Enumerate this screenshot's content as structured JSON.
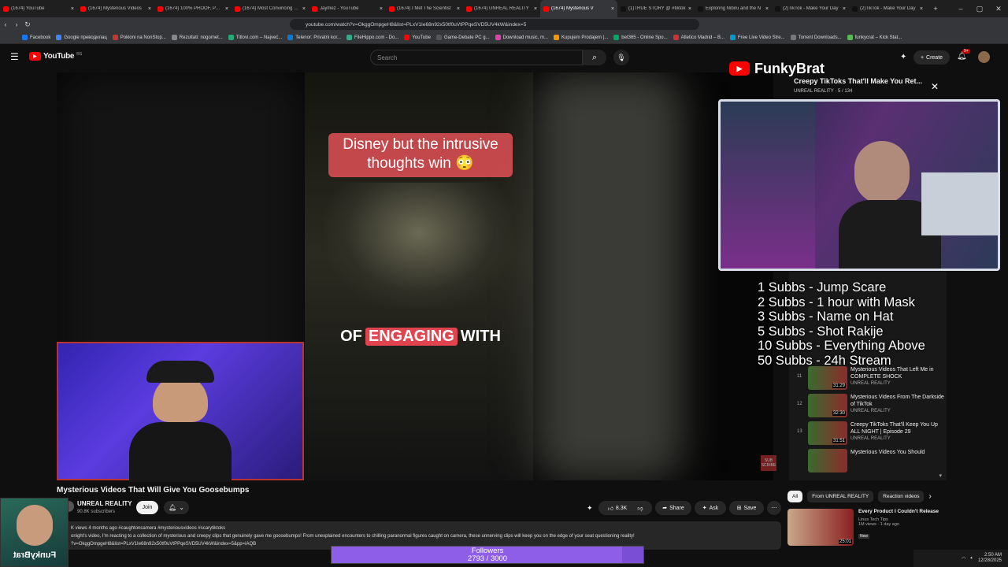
{
  "browser": {
    "tabs": [
      {
        "label": "(1674) YouTube",
        "active": false,
        "color": "#ff0000"
      },
      {
        "label": "(1674) Mysterious Videos",
        "active": false,
        "color": "#ff0000"
      },
      {
        "label": "(1674) 100% PROOF, PARA",
        "active": false,
        "color": "#ff0000"
      },
      {
        "label": "(1674) Most Convincing Evi",
        "active": false,
        "color": "#ff0000"
      },
      {
        "label": "Jaymez - YouTube",
        "active": false,
        "color": "#ff0000"
      },
      {
        "label": "(1674) I Met The Scientist",
        "active": false,
        "color": "#ff0000"
      },
      {
        "label": "(1674) UNREAL REALITY",
        "active": false,
        "color": "#ff0000"
      },
      {
        "label": "(1674) Mysterious V",
        "active": true,
        "color": "#ff0000"
      },
      {
        "label": "(1)TRUE STORY @ #tiktok",
        "active": false,
        "color": "#111111"
      },
      {
        "label": "Exploring Nibiru and the N",
        "active": false,
        "color": "#111111"
      },
      {
        "label": "(2)TikTok - Make Your Day",
        "active": false,
        "color": "#111111"
      },
      {
        "label": "(2)TikTok - Make Your Day",
        "active": false,
        "color": "#111111"
      }
    ],
    "url": "youtube.com/watch?v=OkggOmpgeH8&list=PLxV1Ie68n92x50tf0uVtPPqeSVD5UV4kW&index=5",
    "bookmarks": [
      "Facebook",
      "Google преводилац",
      "Pokloni na NonStop...",
      "Rezultati: nogomet...",
      "Titlovi.com – Najveć...",
      "Telenor: Privatni kor...",
      "FileHippo.com - Do...",
      "YouTube",
      "Game-Debate PC g...",
      "Download music, m...",
      "Kupujem Prodajem |...",
      "bet365 - Online Spo...",
      "Atletico Madrid – B...",
      "Free Live Video Stre...",
      "Torrent Downloads...",
      "funkycrat – Kick Stat..."
    ]
  },
  "youtube": {
    "logo": "YouTube",
    "region": "RS",
    "search_placeholder": "Search",
    "create_label": "Create",
    "notif_count": "9+"
  },
  "video": {
    "caption_top": "Disney but the intrusive thoughts win 😳",
    "caption_pre": "OF",
    "caption_hl": "ENGAGING",
    "caption_post": "WITH",
    "title": "Mysterious Videos That Will Give You Goosebumps",
    "channel": "UNREAL REALITY",
    "subscribers": "90.8K subscribers",
    "join": "Join",
    "likes": "8.3K",
    "share": "Share",
    "ask": "Ask",
    "save": "Save",
    "desc_line1": "K views  4 months ago  #caughtoncamera #mysteriousvideos #scarytiktoks",
    "desc_line2": "onight's video, I'm reacting to a collection of mysterious and creepy clips that genuinely gave me goosebumps! From unexplained encounters to chilling paranormal figures caught on camera, these unnerving clips will keep you on the edge of your seat questioning reality!",
    "desc_line3": "?v=OkggOmpgeH8&list=PLxV1Ie68n92x50tf0uVtPPqeSVD5UV4kW&index=5&pp=iAQB"
  },
  "overlay": {
    "streamer": "FunkyBrat",
    "streamer_tag": "FunkyBrat",
    "goals": [
      "1 Subbs - Jump Scare",
      "2 Subbs - 1 hour with Mask",
      "3 Subbs - Name on Hat",
      "5 Subbs - Shot Rakije",
      "10 Subbs - Everything Above",
      "50 Subbs - 24h Stream"
    ],
    "followers_label": "Followers",
    "followers_count": "2793 / 3000",
    "followers_current": 2793,
    "followers_goal": 3000,
    "subscribe_tag": "SUB SCRIBE"
  },
  "playlist": {
    "title": "Creepy TikToks That'll Make You Ret...",
    "subtitle": "UNREAL REALITY · 5 / 134",
    "items": [
      {
        "idx": "11",
        "title": "Mysterious Videos That Left Me in COMPLETE SHOCK",
        "channel": "UNREAL REALITY",
        "duration": "31:29"
      },
      {
        "idx": "12",
        "title": "Mysterious Videos From The Darkside of TikTok",
        "channel": "UNREAL REALITY",
        "duration": "32:30"
      },
      {
        "idx": "13",
        "title": "Creepy TikToks That'll Keep You Up ALL NIGHT | Episode 29",
        "channel": "UNREAL REALITY",
        "duration": "31:51"
      },
      {
        "idx": "",
        "title": "Mysterious Videos You Should",
        "channel": "",
        "duration": ""
      }
    ]
  },
  "sidebar": {
    "chips": [
      "All",
      "From UNREAL REALITY",
      "Reaction videos"
    ],
    "rec_title": "Every Product I Couldn't Release",
    "rec_channel": "Linus Tech Tips",
    "rec_meta": "1M views · 1 day ago",
    "rec_badge": "New",
    "rec_duration": "25:01"
  },
  "taskbar": {
    "time": "2:50 AM",
    "date": "12/28/2025"
  }
}
